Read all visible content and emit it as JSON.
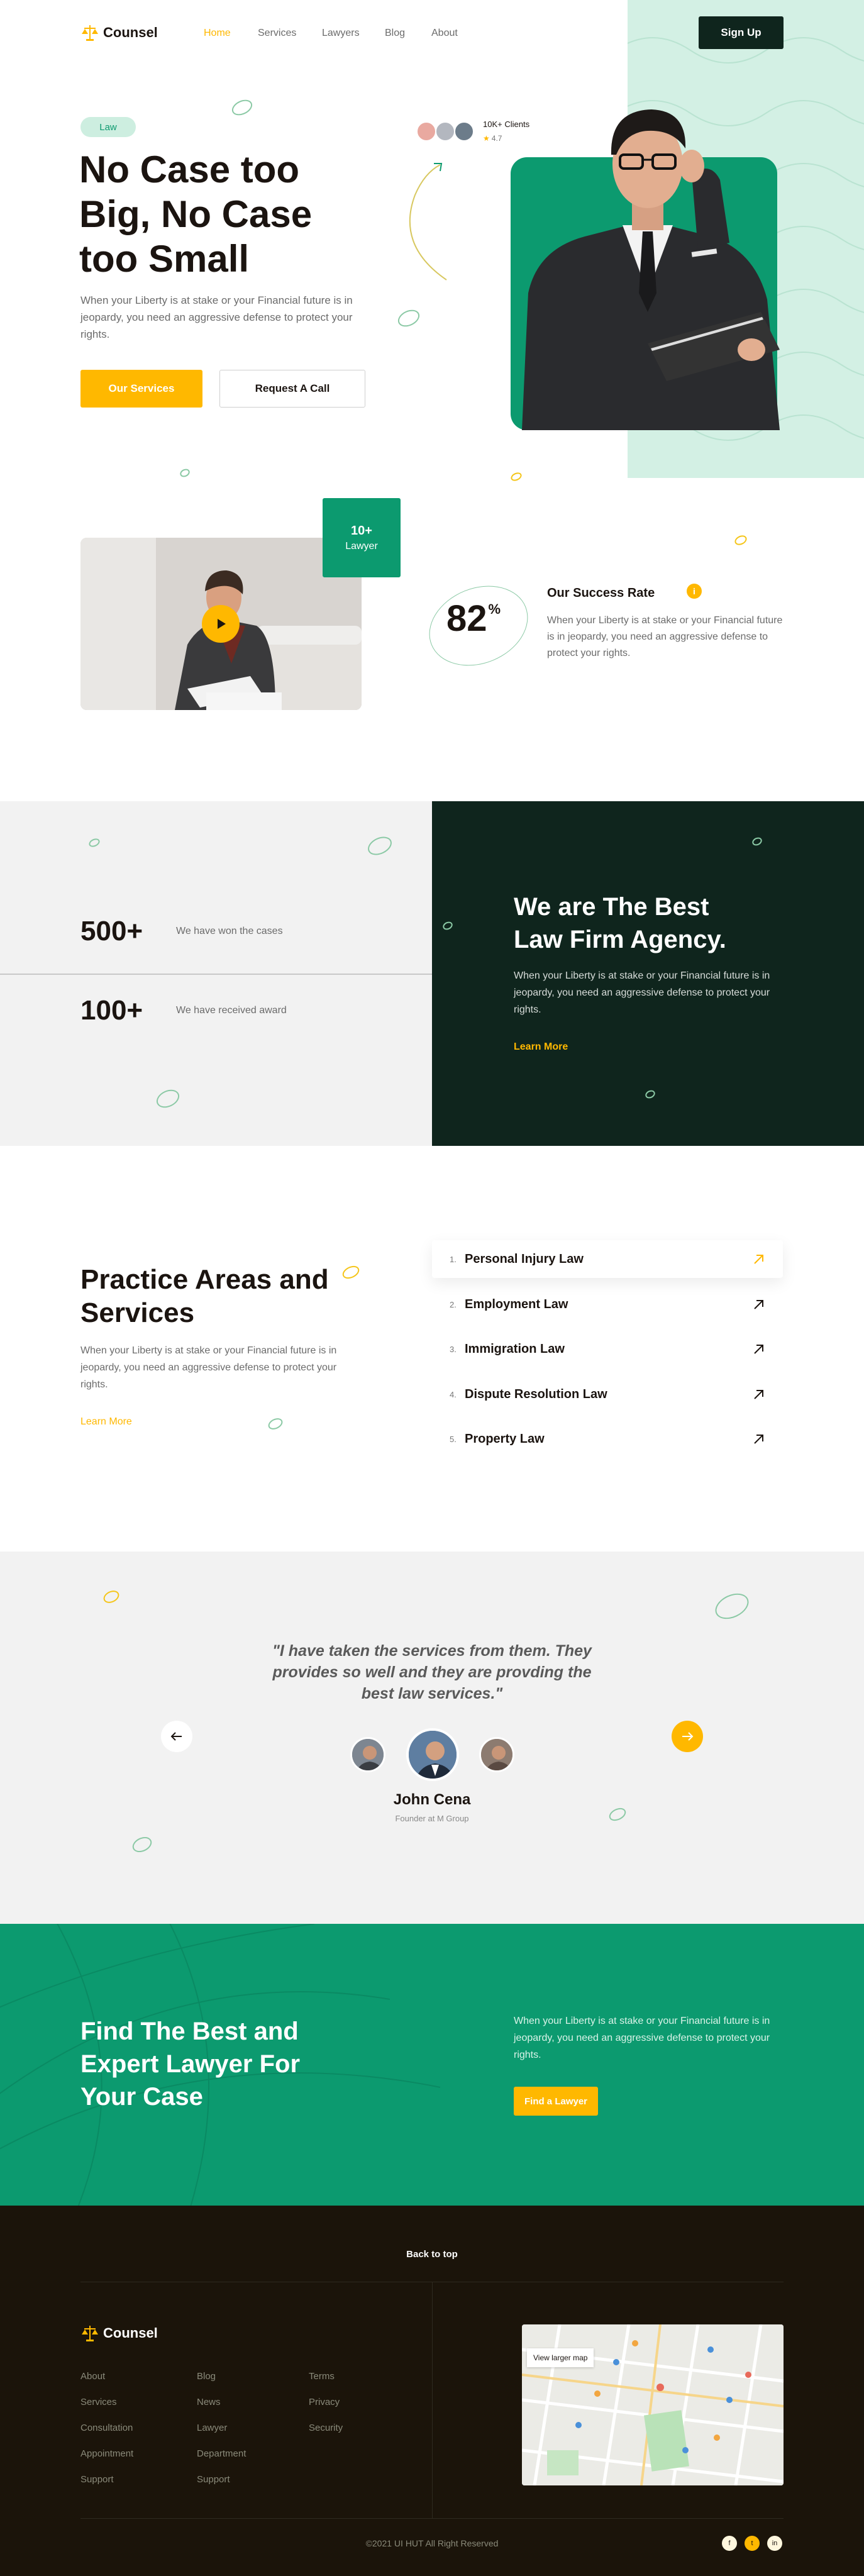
{
  "brand": {
    "name": "Counsel",
    "accent": "#ffb800",
    "green": "#0c9a6f",
    "dark": "#0f251d",
    "footer_bg": "#1b140a"
  },
  "nav": {
    "items": [
      {
        "label": "Home",
        "active": true
      },
      {
        "label": "Services"
      },
      {
        "label": "Lawyers"
      },
      {
        "label": "Blog"
      },
      {
        "label": "About"
      }
    ],
    "signup_label": "Sign Up"
  },
  "hero": {
    "tag": "Law",
    "title_line1": "No Case too",
    "title_line2": "Big, No Case",
    "title_line3": "too Small",
    "description": "When your Liberty is at stake or your Financial future is in jeopardy, you need an aggressive defense to protect your rights.",
    "primary_button": "Our Services",
    "secondary_button": "Request A Call",
    "clients_label": "10K+ Clients",
    "rating": "4.7"
  },
  "about": {
    "badge_number": "10+",
    "badge_label": "Lawyer",
    "success_value": "82",
    "success_unit": "%",
    "success_title": "Our Success Rate",
    "success_text": "When your Liberty is at stake or your Financial future is in jeopardy, you need an aggressive defense to protect your rights."
  },
  "stats": {
    "items": [
      {
        "value": "500+",
        "label": "We have won the cases"
      },
      {
        "value": "100+",
        "label": "We have received award"
      }
    ],
    "agency_title_line1": "We are The Best",
    "agency_title_line2": "Law Firm Agency.",
    "agency_text": "When your Liberty is at stake or your Financial future is in jeopardy, you need an aggressive defense to protect your rights.",
    "agency_link": "Learn More"
  },
  "practice": {
    "title_line1": "Practice Areas and",
    "title_line2": "Services",
    "text": "When your Liberty is at stake or your Financial future is in jeopardy, you need an aggressive defense to protect your rights.",
    "link": "Learn More",
    "items": [
      {
        "num": "1.",
        "label": "Personal Injury Law"
      },
      {
        "num": "2.",
        "label": "Employment Law"
      },
      {
        "num": "3.",
        "label": "Immigration Law"
      },
      {
        "num": "4.",
        "label": "Dispute Resolution Law"
      },
      {
        "num": "5.",
        "label": "Property Law"
      }
    ]
  },
  "testimonial": {
    "quote_line1": "\"I have taken the services from them. They",
    "quote_line2": "provides so well and they are provding the",
    "quote_line3": "best law services.\"",
    "name": "John Cena",
    "role": "Founder at M Group"
  },
  "cta": {
    "title_line1": "Find The Best and",
    "title_line2": "Expert Lawyer For",
    "title_line3": "Your Case",
    "text": "When your Liberty is at stake or your Financial future is in jeopardy, you need an aggressive defense to protect your rights.",
    "button": "Find a Lawyer"
  },
  "footer": {
    "back_to_top": "Back to top",
    "col1": [
      "About",
      "Services",
      "Consultation",
      "Appointment",
      "Support"
    ],
    "col2": [
      "Blog",
      "News",
      "Lawyer",
      "Department",
      "Support"
    ],
    "col3": [
      "Terms",
      "Privacy",
      "Security"
    ],
    "map_button": "View larger map",
    "copyright": "©2021 UI HUT All Right Reserved"
  }
}
